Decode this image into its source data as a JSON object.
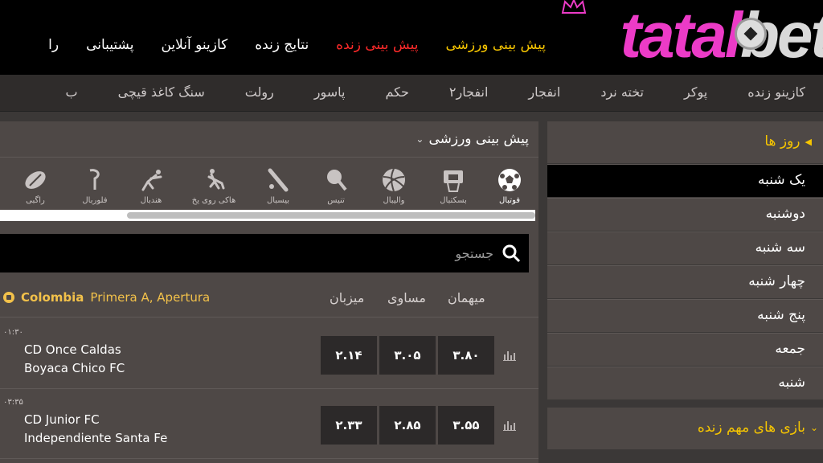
{
  "logo": {
    "text_main": "tatal",
    "text_b": "bet"
  },
  "main_nav": {
    "sports_betting": "پیش بینی ورزشی",
    "live_betting": "پیش بینی زنده",
    "live_results": "نتایج زنده",
    "online_casino": "کازینو آنلاین",
    "support": "پشتیبانی",
    "more": "را"
  },
  "casino_nav": [
    "کازینو زنده",
    "پوکر",
    "تخته نرد",
    "انفجار",
    "انفجار۲",
    "حکم",
    "پاسور",
    "رولت",
    "سنگ کاغذ قیچی",
    "ب"
  ],
  "sport_section": {
    "title": "پیش بینی ورزشی",
    "sports": [
      {
        "label": "فوتبال",
        "icon": "soccer-ball-icon",
        "active": true
      },
      {
        "label": "بسکتبال",
        "icon": "basketball-hoop-icon"
      },
      {
        "label": "والیبال",
        "icon": "volleyball-icon"
      },
      {
        "label": "تنیس",
        "icon": "tennis-racket-icon"
      },
      {
        "label": "بیسبال",
        "icon": "baseball-bat-icon"
      },
      {
        "label": "هاکی روی یخ",
        "icon": "ice-hockey-icon"
      },
      {
        "label": "هندبال",
        "icon": "handball-icon"
      },
      {
        "label": "فلوربال",
        "icon": "floorball-icon"
      },
      {
        "label": "راگبی",
        "icon": "rugby-ball-icon"
      }
    ]
  },
  "search": {
    "placeholder": "جستجو"
  },
  "league": {
    "country": "Colombia",
    "name": "Primera A, Apertura",
    "col_home": "میزبان",
    "col_draw": "مساوی",
    "col_away": "میهمان"
  },
  "matches": [
    {
      "time": "۰۱:۳۰",
      "home": "CD Once Caldas",
      "away": "Boyaca Chico FC",
      "odd_home": "۲.۱۴",
      "odd_draw": "۳.۰۵",
      "odd_away": "۳.۸۰"
    },
    {
      "time": "۰۳:۳۵",
      "home": "CD Junior FC",
      "away": "Independiente Santa Fe",
      "odd_home": "۲.۳۳",
      "odd_draw": "۲.۸۵",
      "odd_away": "۳.۵۵"
    }
  ],
  "sidebar": {
    "days_title": "روز ها",
    "days": [
      "یک شنبه",
      "دوشنبه",
      "سه شنبه",
      "چهار شنبه",
      "پنج شنبه",
      "جمعه",
      "شنبه"
    ],
    "live_title": "بازی های مهم زنده"
  },
  "colors": {
    "accent": "#f6c500",
    "brand": "#ec3bc7",
    "live": "#ff2a2a"
  }
}
